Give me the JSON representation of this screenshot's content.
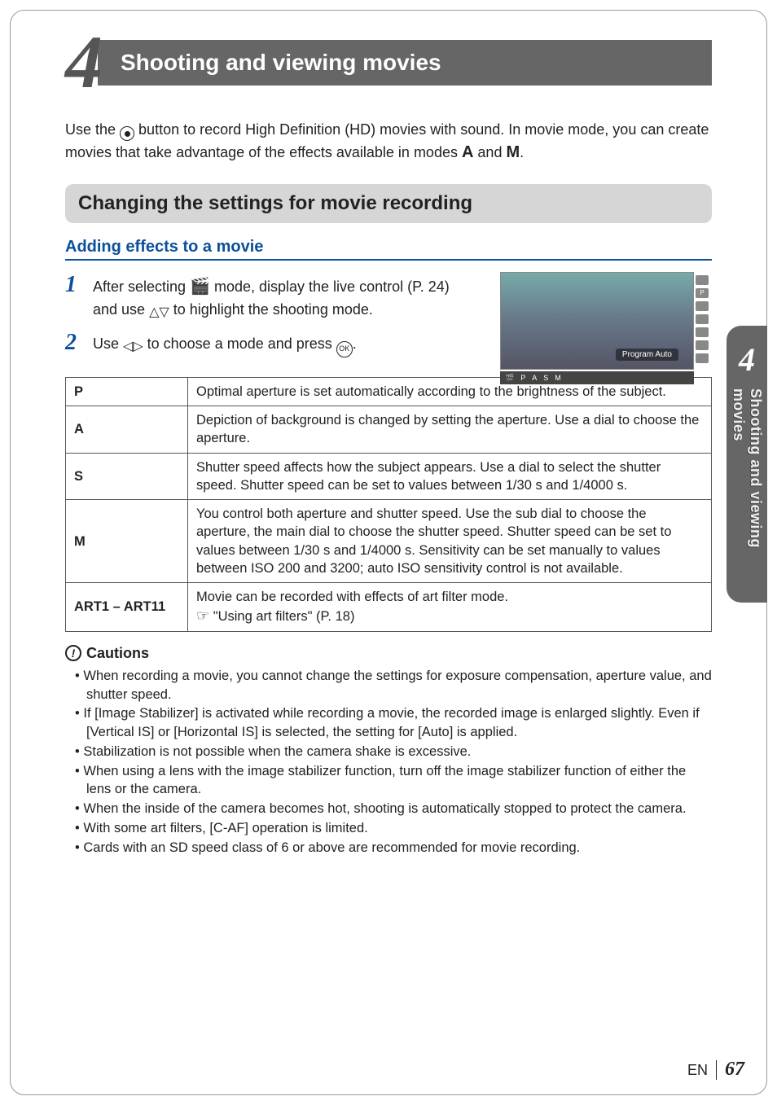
{
  "chapter": {
    "number": "4",
    "title": "Shooting and viewing movies"
  },
  "sideTab": {
    "number": "4",
    "label": "Shooting and viewing movies"
  },
  "intro": {
    "part1": "Use the ",
    "part2": " button to record High Definition (HD) movies with sound. In movie mode, you can create movies that take advantage of the effects available in modes ",
    "modeA": "A",
    "and": " and ",
    "modeM": "M",
    "end": "."
  },
  "section": {
    "title": "Changing the settings for movie recording"
  },
  "subsection": {
    "title": "Adding effects to a movie"
  },
  "steps": {
    "s1": {
      "num": "1",
      "p1": "After selecting ",
      "p2": " mode, display the live control (P. 24) and use ",
      "p3": " to highlight the shooting mode."
    },
    "s2": {
      "num": "2",
      "p1": "Use ",
      "p2": " to choose a mode and press ",
      "p3": "."
    }
  },
  "thumb": {
    "label": "Program Auto",
    "bar": {
      "p": "P",
      "a": "A",
      "s": "S",
      "m": "M"
    },
    "iconP": "P"
  },
  "table": {
    "r1": {
      "label": "P",
      "desc": "Optimal aperture is set automatically according to the brightness of the subject."
    },
    "r2": {
      "label": "A",
      "desc": "Depiction of background is changed by setting the aperture. Use a dial to choose the aperture."
    },
    "r3": {
      "label": "S",
      "desc": "Shutter speed affects how the subject appears. Use a dial to select the shutter speed. Shutter speed can be set to values between 1/30 s and 1/4000 s."
    },
    "r4": {
      "label": "M",
      "desc": "You control both aperture and shutter speed. Use the sub dial to choose the aperture, the main dial to choose the shutter speed. Shutter speed can be set to values between 1/30 s and 1/4000 s. Sensitivity can be set manually to values between ISO 200 and 3200; auto ISO sensitivity control is not available."
    },
    "r5": {
      "label": "ART1 – ART11",
      "desc": "Movie can be recorded with effects of art filter mode.",
      "ref": "  \"Using art filters\" (P. 18)"
    }
  },
  "cautions": {
    "head": "Cautions",
    "c1": "When recording a movie, you cannot change the settings for exposure compensation, aperture value, and shutter speed.",
    "c2": "If [Image Stabilizer] is activated while recording a movie, the recorded image is enlarged slightly. Even if [Vertical IS] or [Horizontal IS] is selected, the setting for [Auto] is applied.",
    "c3": "Stabilization is not possible when the camera shake is excessive.",
    "c4": "When using a lens with the image stabilizer function, turn off the image stabilizer function of either the lens or the camera.",
    "c5": "When the inside of the camera becomes hot, shooting is automatically stopped to protect the camera.",
    "c6": "With some art filters, [C-AF] operation is limited.",
    "c7": "Cards with an SD speed class of 6 or above are recommended for movie recording."
  },
  "footer": {
    "lang": "EN",
    "page": "67"
  }
}
